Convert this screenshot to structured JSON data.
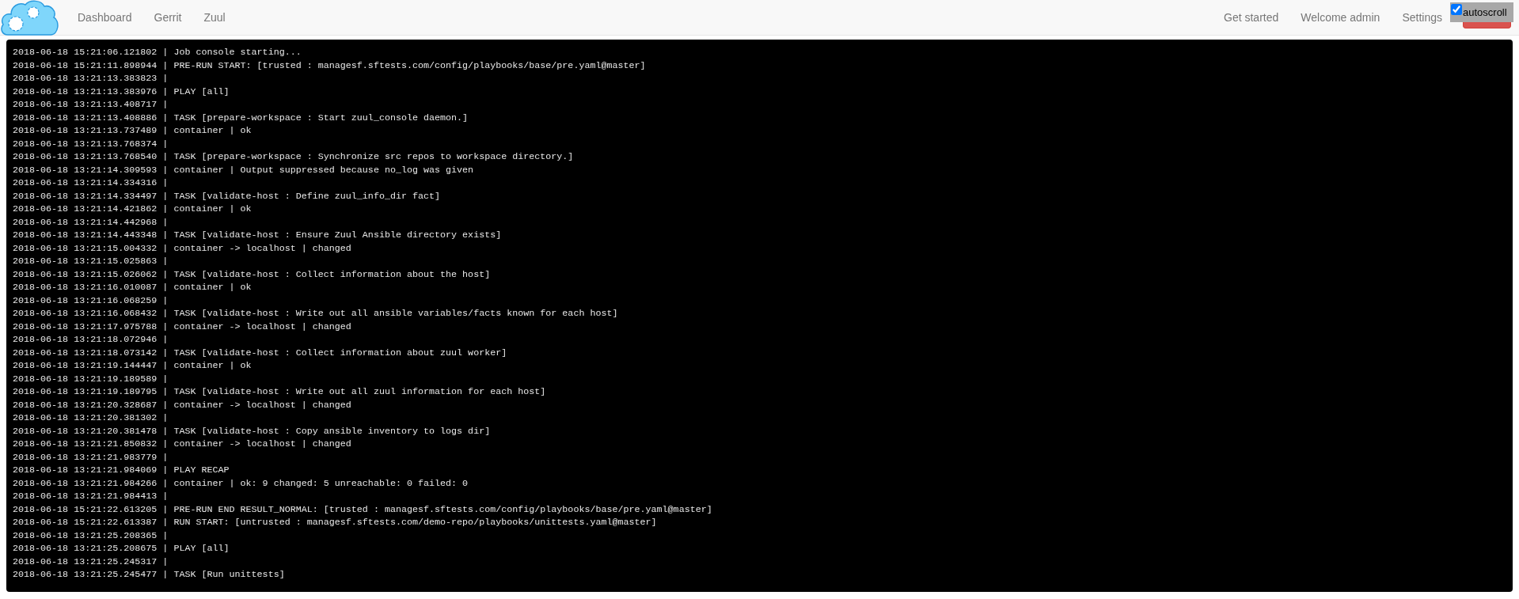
{
  "navbar": {
    "left_links": [
      "Dashboard",
      "Gerrit",
      "Zuul"
    ],
    "right_links": [
      "Get started",
      "Welcome admin",
      "Settings"
    ],
    "autoscroll": {
      "label": "autoscroll",
      "checked": true
    }
  },
  "console": {
    "lines": [
      "2018-06-18 15:21:06.121802 | Job console starting...",
      "2018-06-18 15:21:11.898944 | PRE-RUN START: [trusted : managesf.sftests.com/config/playbooks/base/pre.yaml@master]",
      "2018-06-18 13:21:13.383823 |",
      "2018-06-18 13:21:13.383976 | PLAY [all]",
      "2018-06-18 13:21:13.408717 |",
      "2018-06-18 13:21:13.408886 | TASK [prepare-workspace : Start zuul_console daemon.]",
      "2018-06-18 13:21:13.737489 | container | ok",
      "2018-06-18 13:21:13.768374 |",
      "2018-06-18 13:21:13.768540 | TASK [prepare-workspace : Synchronize src repos to workspace directory.]",
      "2018-06-18 13:21:14.309593 | container | Output suppressed because no_log was given",
      "2018-06-18 13:21:14.334316 |",
      "2018-06-18 13:21:14.334497 | TASK [validate-host : Define zuul_info_dir fact]",
      "2018-06-18 13:21:14.421862 | container | ok",
      "2018-06-18 13:21:14.442968 |",
      "2018-06-18 13:21:14.443348 | TASK [validate-host : Ensure Zuul Ansible directory exists]",
      "2018-06-18 13:21:15.004332 | container -> localhost | changed",
      "2018-06-18 13:21:15.025863 |",
      "2018-06-18 13:21:15.026062 | TASK [validate-host : Collect information about the host]",
      "2018-06-18 13:21:16.010087 | container | ok",
      "2018-06-18 13:21:16.068259 |",
      "2018-06-18 13:21:16.068432 | TASK [validate-host : Write out all ansible variables/facts known for each host]",
      "2018-06-18 13:21:17.975788 | container -> localhost | changed",
      "2018-06-18 13:21:18.072946 |",
      "2018-06-18 13:21:18.073142 | TASK [validate-host : Collect information about zuul worker]",
      "2018-06-18 13:21:19.144447 | container | ok",
      "2018-06-18 13:21:19.189589 |",
      "2018-06-18 13:21:19.189795 | TASK [validate-host : Write out all zuul information for each host]",
      "2018-06-18 13:21:20.328687 | container -> localhost | changed",
      "2018-06-18 13:21:20.381302 |",
      "2018-06-18 13:21:20.381478 | TASK [validate-host : Copy ansible inventory to logs dir]",
      "2018-06-18 13:21:21.850832 | container -> localhost | changed",
      "2018-06-18 13:21:21.983779 |",
      "2018-06-18 13:21:21.984069 | PLAY RECAP",
      "2018-06-18 13:21:21.984266 | container | ok: 9 changed: 5 unreachable: 0 failed: 0",
      "2018-06-18 13:21:21.984413 |",
      "2018-06-18 15:21:22.613205 | PRE-RUN END RESULT_NORMAL: [trusted : managesf.sftests.com/config/playbooks/base/pre.yaml@master]",
      "2018-06-18 15:21:22.613387 | RUN START: [untrusted : managesf.sftests.com/demo-repo/playbooks/unittests.yaml@master]",
      "2018-06-18 13:21:25.208365 |",
      "2018-06-18 13:21:25.208675 | PLAY [all]",
      "2018-06-18 13:21:25.245317 |",
      "2018-06-18 13:21:25.245477 | TASK [Run unittests]"
    ]
  }
}
